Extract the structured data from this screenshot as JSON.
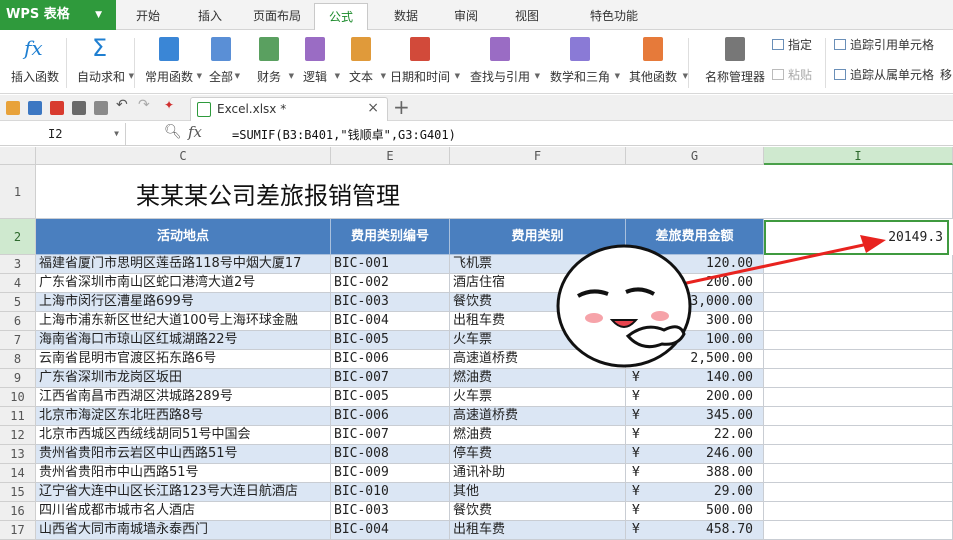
{
  "app": {
    "logo": "WPS 表格"
  },
  "menu": {
    "tabs": [
      "开始",
      "插入",
      "页面布局",
      "公式",
      "数据",
      "审阅",
      "视图",
      "特色功能"
    ],
    "active": "公式"
  },
  "ribbon": {
    "buttons": [
      {
        "label": "插入函数",
        "icon": "fx-icon"
      },
      {
        "label": "自动求和",
        "icon": "sigma-icon",
        "dd": true
      },
      {
        "label": "常用函数",
        "icon": "star-book-icon",
        "dd": true
      },
      {
        "label": "全部",
        "icon": "list-book-icon",
        "dd": true
      },
      {
        "label": "财务",
        "icon": "finance-book-icon",
        "dd": true
      },
      {
        "label": "逻辑",
        "icon": "logic-book-icon",
        "dd": true
      },
      {
        "label": "文本",
        "icon": "text-book-icon",
        "dd": true
      },
      {
        "label": "日期和时间",
        "icon": "clock-book-icon",
        "dd": true
      },
      {
        "label": "查找与引用",
        "icon": "search-book-icon",
        "dd": true
      },
      {
        "label": "数学和三角",
        "icon": "math-book-icon",
        "dd": true
      },
      {
        "label": "其他函数",
        "icon": "dots-book-icon",
        "dd": true
      },
      {
        "label": "名称管理器",
        "icon": "name-manager-icon"
      }
    ],
    "small": {
      "specify": "指定",
      "paste": "粘贴",
      "trace_precedents": "追踪引用单元格",
      "trace_dependents": "追踪从属单元格",
      "cut": "移"
    }
  },
  "document": {
    "tab_name": "Excel.xlsx *"
  },
  "formula_bar": {
    "name_box": "I2",
    "fx": "fx",
    "formula": "=SUMIF(B3:B401,\"钱顺卓\",G3:G401)"
  },
  "columns": [
    "C",
    "E",
    "F",
    "G",
    "I"
  ],
  "rows": [
    "1",
    "2",
    "3",
    "4",
    "5",
    "6",
    "7",
    "8",
    "9",
    "10",
    "11",
    "12",
    "13",
    "14",
    "15",
    "16",
    "17"
  ],
  "sheet": {
    "title": "某某某公司差旅报销管理",
    "headers": {
      "location": "活动地点",
      "code": "费用类别编号",
      "category": "费用类别",
      "amount": "差旅费用金额"
    },
    "i2_value": "20149.3",
    "records": [
      {
        "location": "福建省厦门市思明区莲岳路118号中烟大厦17",
        "code": "BIC-001",
        "category": "飞机票",
        "currency": "",
        "amount": "120.00"
      },
      {
        "location": "广东省深圳市南山区蛇口港湾大道2号",
        "code": "BIC-002",
        "category": "酒店住宿",
        "currency": "",
        "amount": "200.00"
      },
      {
        "location": "上海市闵行区漕星路699号",
        "code": "BIC-003",
        "category": "餐饮费",
        "currency": "",
        "amount": "3,000.00"
      },
      {
        "location": "上海市浦东新区世纪大道100号上海环球金融",
        "code": "BIC-004",
        "category": "出租车费",
        "currency": "",
        "amount": "300.00"
      },
      {
        "location": "海南省海口市琼山区红城湖路22号",
        "code": "BIC-005",
        "category": "火车票",
        "currency": "",
        "amount": "100.00"
      },
      {
        "location": "云南省昆明市官渡区拓东路6号",
        "code": "BIC-006",
        "category": "高速道桥费",
        "currency": "¥",
        "amount": "2,500.00"
      },
      {
        "location": "广东省深圳市龙岗区坂田",
        "code": "BIC-007",
        "category": "燃油费",
        "currency": "¥",
        "amount": "140.00"
      },
      {
        "location": "江西省南昌市西湖区洪城路289号",
        "code": "BIC-005",
        "category": "火车票",
        "currency": "¥",
        "amount": "200.00"
      },
      {
        "location": "北京市海淀区东北旺西路8号",
        "code": "BIC-006",
        "category": "高速道桥费",
        "currency": "¥",
        "amount": "345.00"
      },
      {
        "location": "北京市西城区西绒线胡同51号中国会",
        "code": "BIC-007",
        "category": "燃油费",
        "currency": "¥",
        "amount": "22.00"
      },
      {
        "location": "贵州省贵阳市云岩区中山西路51号",
        "code": "BIC-008",
        "category": "停车费",
        "currency": "¥",
        "amount": "246.00"
      },
      {
        "location": "贵州省贵阳市中山西路51号",
        "code": "BIC-009",
        "category": "通讯补助",
        "currency": "¥",
        "amount": "388.00"
      },
      {
        "location": "辽宁省大连中山区长江路123号大连日航酒店",
        "code": "BIC-010",
        "category": "其他",
        "currency": "¥",
        "amount": "29.00"
      },
      {
        "location": "四川省成都市城市名人酒店",
        "code": "BIC-003",
        "category": "餐饮费",
        "currency": "¥",
        "amount": "500.00"
      },
      {
        "location": "山西省大同市南城墙永泰西门",
        "code": "BIC-004",
        "category": "出租车费",
        "currency": "¥",
        "amount": "458.70"
      }
    ]
  }
}
